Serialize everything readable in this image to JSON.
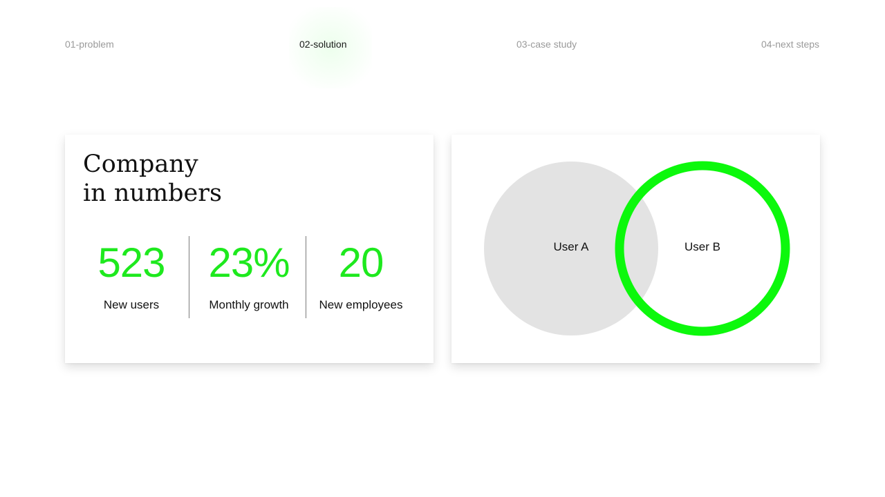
{
  "nav": {
    "items": [
      {
        "label": "01-problem",
        "active": false
      },
      {
        "label": "02-solution",
        "active": true
      },
      {
        "label": "03-case study",
        "active": false
      },
      {
        "label": "04-next steps",
        "active": false
      }
    ]
  },
  "stats_card": {
    "title_line1": "Company",
    "title_line2": "in numbers",
    "stats": [
      {
        "value": "523",
        "label": "New users"
      },
      {
        "value": "23%",
        "label": "Monthly growth"
      },
      {
        "value": "20",
        "label": "New employees"
      }
    ]
  },
  "venn": {
    "set_a": "User A",
    "set_b": "User B"
  },
  "colors": {
    "accent": "#1ee91e",
    "ring": "#0cf80c",
    "circle_fill": "#e3e3e3",
    "text": "#111111",
    "muted": "#9a9a9a"
  }
}
